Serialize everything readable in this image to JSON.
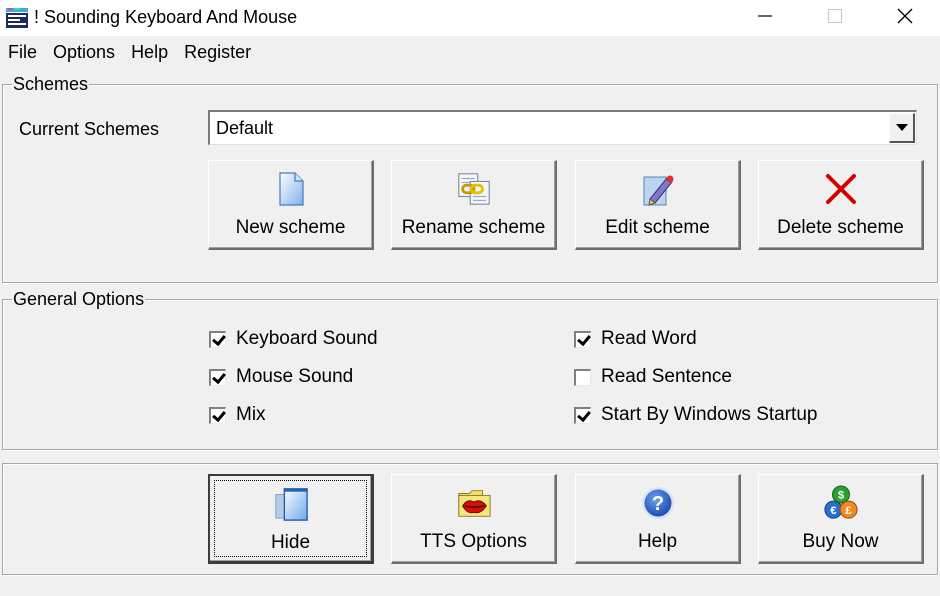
{
  "window": {
    "title": "! Sounding Keyboard And Mouse",
    "app_icon": "keyboard-app-icon",
    "controls": {
      "minimize": "minimize-icon",
      "maximize": "maximize-icon",
      "close": "close-icon"
    }
  },
  "menu": {
    "items": [
      {
        "label": "File"
      },
      {
        "label": "Options"
      },
      {
        "label": "Help"
      },
      {
        "label": "Register"
      }
    ]
  },
  "schemes": {
    "group_label": "Schemes",
    "current_label": "Current Schemes",
    "current_value": "Default",
    "buttons": [
      {
        "label": "New scheme",
        "icon": "new-document-icon"
      },
      {
        "label": "Rename scheme",
        "icon": "rename-link-icon"
      },
      {
        "label": "Edit scheme",
        "icon": "edit-pencil-icon"
      },
      {
        "label": "Delete scheme",
        "icon": "delete-x-icon"
      }
    ]
  },
  "general_options": {
    "group_label": "General Options",
    "options": [
      {
        "label": "Keyboard Sound",
        "checked": true
      },
      {
        "label": "Mouse Sound",
        "checked": true
      },
      {
        "label": "Mix",
        "checked": true
      },
      {
        "label": "Read Word",
        "checked": true
      },
      {
        "label": "Read Sentence",
        "checked": false
      },
      {
        "label": "Start By Windows Startup",
        "checked": true
      }
    ]
  },
  "actions": {
    "buttons": [
      {
        "label": "Hide",
        "icon": "windows-stack-icon",
        "focused": true
      },
      {
        "label": "TTS Options",
        "icon": "lips-folder-icon"
      },
      {
        "label": "Help",
        "icon": "help-question-icon"
      },
      {
        "label": "Buy Now",
        "icon": "currency-coins-icon"
      }
    ]
  },
  "colors": {
    "window_bg": "#f0f0f0",
    "titlebar_bg": "#ffffff",
    "delete_red": "#d40000",
    "help_blue": "#2a63c8"
  }
}
